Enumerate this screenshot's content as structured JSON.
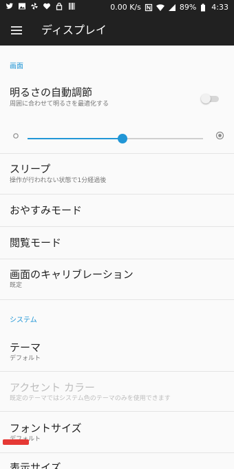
{
  "status_bar": {
    "network_speed": "0.00 K/s",
    "battery": "89%",
    "time": "4:33",
    "left_icons": [
      "twitter-icon",
      "image-icon",
      "pinwheel-icon",
      "heart-icon",
      "lock-icon",
      "barcode-icon"
    ],
    "right_icons": [
      "nfc-icon",
      "wifi-icon",
      "signal-icon",
      "battery-icon"
    ]
  },
  "app_bar": {
    "title": "ディスプレイ",
    "menu_icon": "hamburger-menu-icon"
  },
  "sections": {
    "screen": {
      "header": "画面",
      "auto_brightness_title": "明るさの自動調節",
      "auto_brightness_sub": "周囲に合わせて明るさを最適化する",
      "auto_brightness_enabled": false,
      "brightness_level": 0.54,
      "sleep_title": "スリープ",
      "sleep_sub": "操作が行われない状態で1分経過後",
      "night_mode_title": "おやすみモード",
      "reading_mode_title": "閲覧モード",
      "calibration_title": "画面のキャリブレーション",
      "calibration_sub": "既定"
    },
    "system": {
      "header": "システム",
      "theme_title": "テーマ",
      "theme_sub": "デフォルト",
      "accent_title": "アクセント カラー",
      "accent_sub": "既定のテーマではシステム色のテーマのみを使用できます",
      "font_size_title": "フォントサイズ",
      "font_size_sub": "デフォルト",
      "display_size_title": "表示サイズ"
    }
  },
  "colors": {
    "accent": "#2196d6",
    "bar": "#212121",
    "background": "#fafafa"
  }
}
